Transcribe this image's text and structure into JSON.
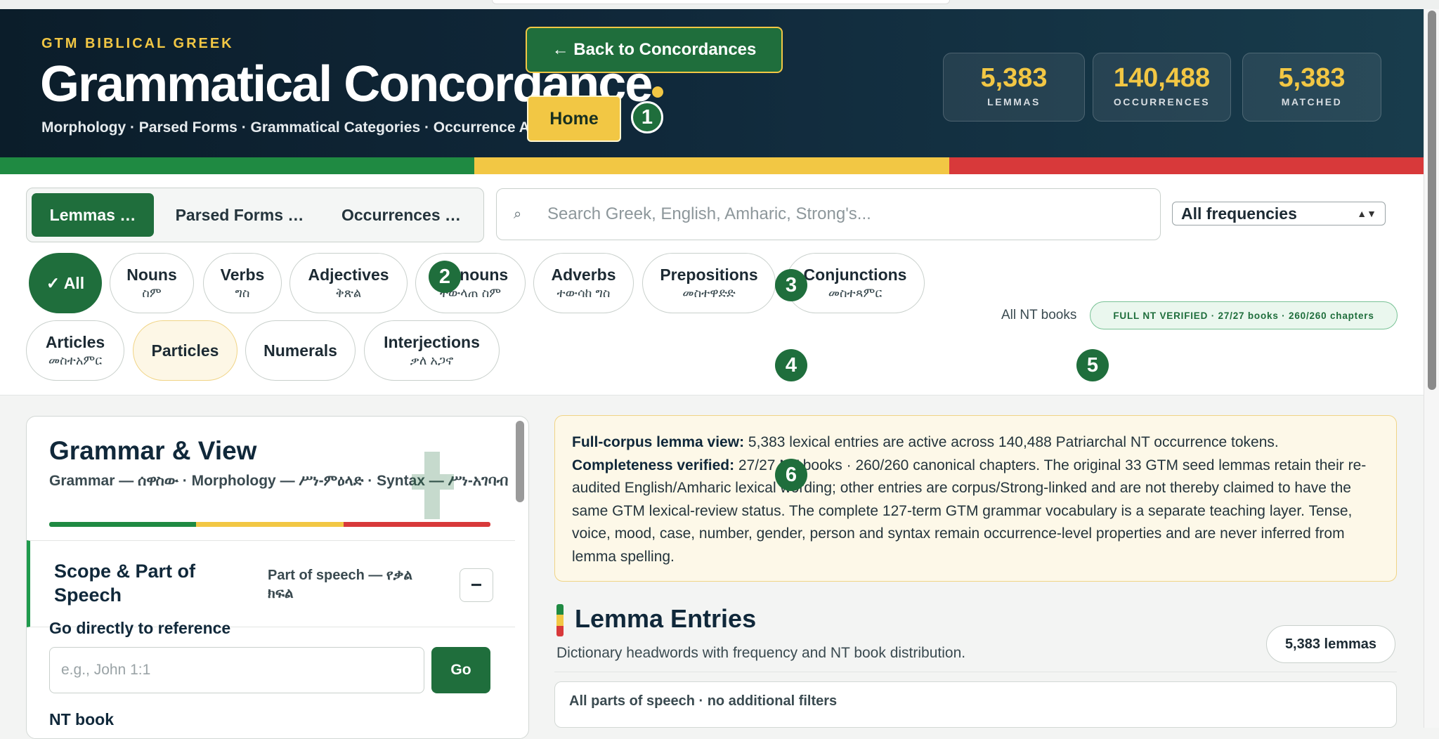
{
  "header": {
    "eyebrow": "GTM BIBLICAL GREEK",
    "title": "Grammatical Concordance",
    "subtitle": "Morphology · Parsed Forms · Grammatical Categories · Occurrence Analysis",
    "back_label": "← Back to Concordances",
    "home_label": "Home",
    "stats": [
      {
        "value": "5,383",
        "label": "LEMMAS"
      },
      {
        "value": "140,488",
        "label": "OCCURRENCES"
      },
      {
        "value": "5,383",
        "label": "MATCHED"
      }
    ]
  },
  "colors": {
    "green": "#1f8a42",
    "yellow": "#f2c744",
    "red": "#d8393a",
    "accent": "#1f6e3c"
  },
  "tabs": [
    "Lemmas …",
    "Parsed Forms …",
    "Occurrences …"
  ],
  "search": {
    "placeholder": "Search Greek, English, Amharic, Strong's...",
    "icon": "search-icon"
  },
  "frequency": {
    "selected": "All frequencies"
  },
  "chips": [
    {
      "en": "✓ All",
      "am": ""
    },
    {
      "en": "Nouns",
      "am": "ስም"
    },
    {
      "en": "Verbs",
      "am": "ግስ"
    },
    {
      "en": "Adjectives",
      "am": "ቅጽል"
    },
    {
      "en": "Pronouns",
      "am": "ተውላጠ ስም"
    },
    {
      "en": "Adverbs",
      "am": "ተውሳከ ግስ"
    },
    {
      "en": "Prepositions",
      "am": "መስተዋድድ"
    },
    {
      "en": "Conjunctions",
      "am": "መስተጻምር"
    },
    {
      "en": "Articles",
      "am": "መስተአምር"
    },
    {
      "en": "Particles",
      "am": ""
    },
    {
      "en": "Numerals",
      "am": ""
    },
    {
      "en": "Interjections",
      "am": "ቃለ አጋኖ"
    }
  ],
  "scope": {
    "label": "All NT books",
    "verified": "FULL NT VERIFIED · 27/27 books · 260/260 chapters"
  },
  "markers": [
    "1",
    "2",
    "3",
    "4",
    "5",
    "6"
  ],
  "sidebar": {
    "title": "Grammar & View",
    "subtitle": "Grammar — ሰዋስው · Morphology — ሥነ-ምዕላድ · Syntax — ሥነ-አገባብ",
    "scope_title": "Scope & Part of Speech",
    "scope_sub": "Part of speech — የቃል ክፍል",
    "collapse_label": "−",
    "goref_label": "Go directly to reference",
    "ref_placeholder": "e.g., John 1:1",
    "go_label": "Go",
    "ntbook_label": "NT book"
  },
  "notice": {
    "b1": "Full-corpus lemma view:",
    "t1": " 5,383 lexical entries are active across 140,488 Patriarchal NT occurrence tokens.",
    "b2": "Completeness verified:",
    "t2": " 27/27 NT books · 260/260 canonical chapters. The original 33 GTM seed lemmas retain their re-audited English/Amharic lexical wording; other entries are corpus/Strong-linked and are not thereby claimed to have the same GTM lexical-review status. The complete 127-term GTM grammar vocabulary is a separate teaching layer. Tense, voice, mood, case, number, gender, person and syntax remain occurrence-level properties and are never inferred from lemma spelling."
  },
  "entries": {
    "title": "Lemma Entries",
    "subtitle": "Dictionary headwords with frequency and NT book distribution.",
    "count": "5,383 lemmas",
    "filter": "All parts of speech · no additional filters"
  }
}
